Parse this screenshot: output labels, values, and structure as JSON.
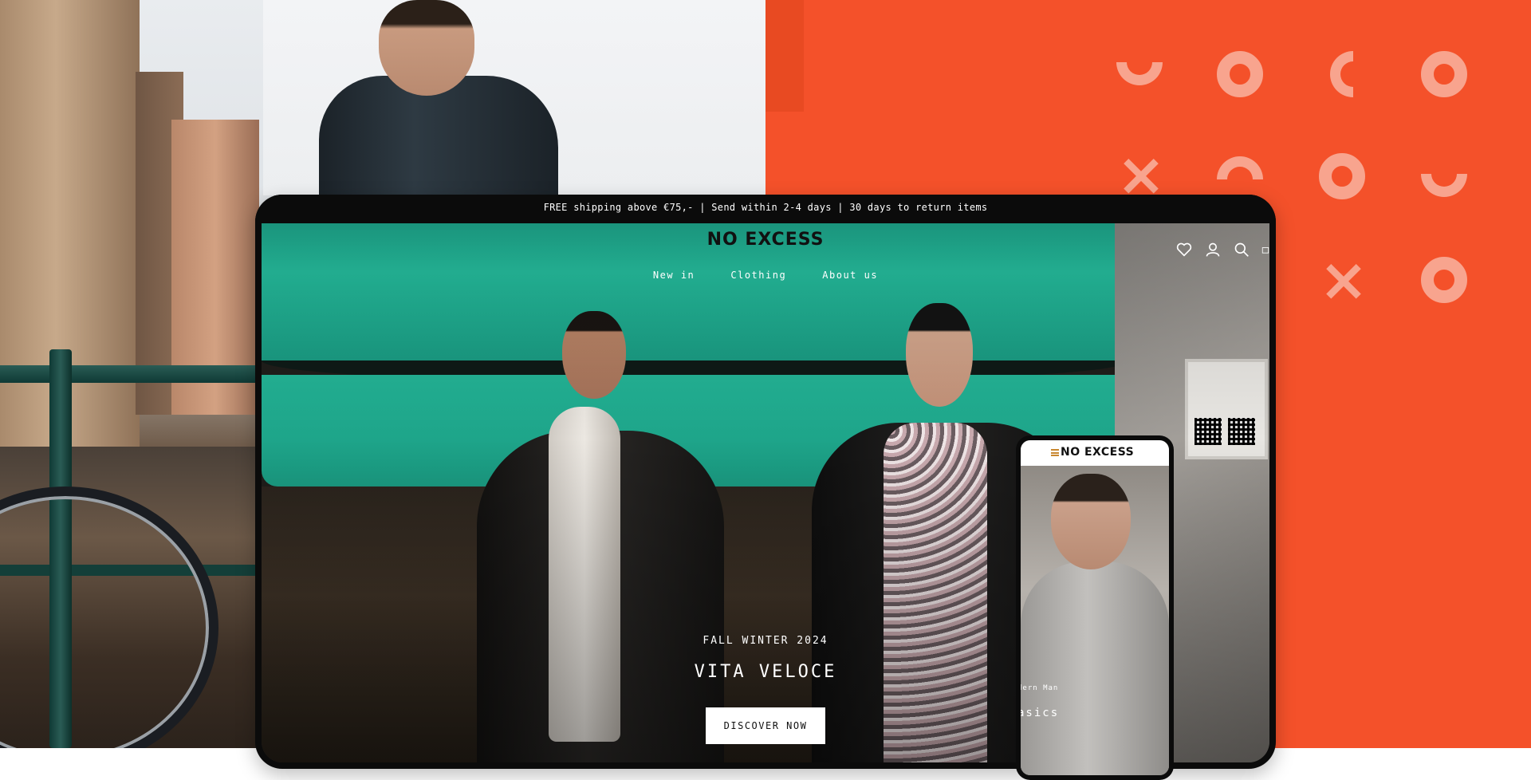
{
  "announcement": "FREE shipping above €75,- | Send within 2-4 days | 30 days to return items",
  "brand": {
    "logo_text": "NO EXCESS"
  },
  "nav": {
    "items": [
      "New in",
      "Clothing",
      "About us"
    ]
  },
  "header_icons": [
    "heart-icon",
    "user-icon",
    "search-icon",
    "bag-icon"
  ],
  "hero": {
    "subtitle": "FALL WINTER 2024",
    "title": "VITA VELOCE",
    "cta": "DISCOVER NOW"
  },
  "mobile": {
    "logo_text": "NO EXCESS",
    "subtitle": "dern Man",
    "title": "asics"
  },
  "colors": {
    "orange_background": "#f4512a",
    "pattern": "#f8a48e",
    "device_frame": "#0b0b0b",
    "menu_accent": "#c8872f"
  }
}
